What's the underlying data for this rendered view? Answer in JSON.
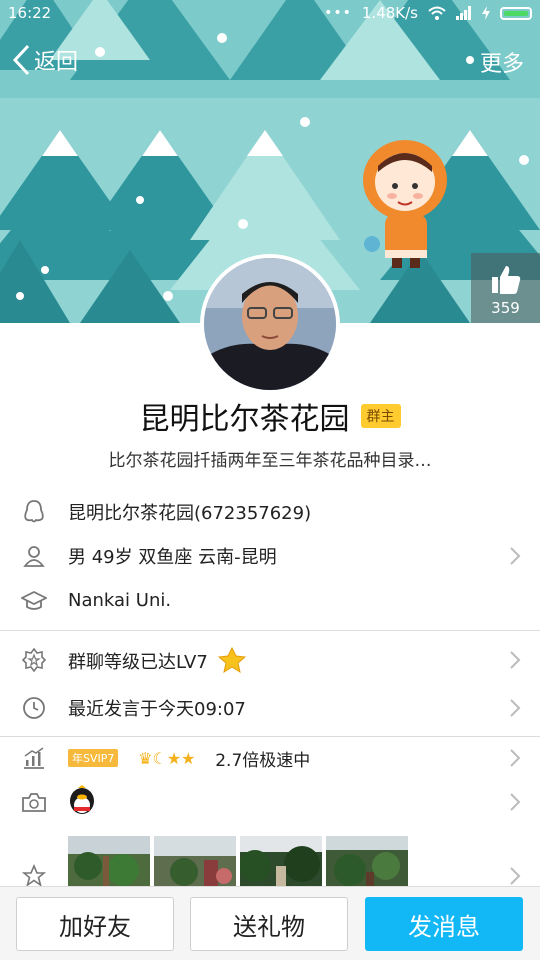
{
  "status_bar": {
    "time": "16:22",
    "dots": "•••",
    "net_speed": "1.48K/s"
  },
  "nav": {
    "back_label": "返回",
    "more_label": "更多"
  },
  "likes": {
    "count": "359"
  },
  "profile": {
    "name": "昆明比尔茶花园",
    "badge": "群主",
    "signature": "比尔茶花园扦插两年至三年茶花品种目录…"
  },
  "info": {
    "account": "昆明比尔茶花园(672357629)",
    "personal": "男   49岁   双鱼座   云南-昆明",
    "school": "Nankai Uni.",
    "group_level": "群聊等级已达LV7",
    "last_post": "最近发言于今天09:07",
    "vip_tag": "年SVIP7",
    "vip_speed": "2.7倍极速中"
  },
  "buttons": {
    "add_friend": "加好友",
    "send_gift": "送礼物",
    "send_message": "发消息"
  },
  "colors": {
    "accent": "#12b7f5",
    "banner": "#8fd3d3",
    "badge": "#ffcb2f"
  }
}
